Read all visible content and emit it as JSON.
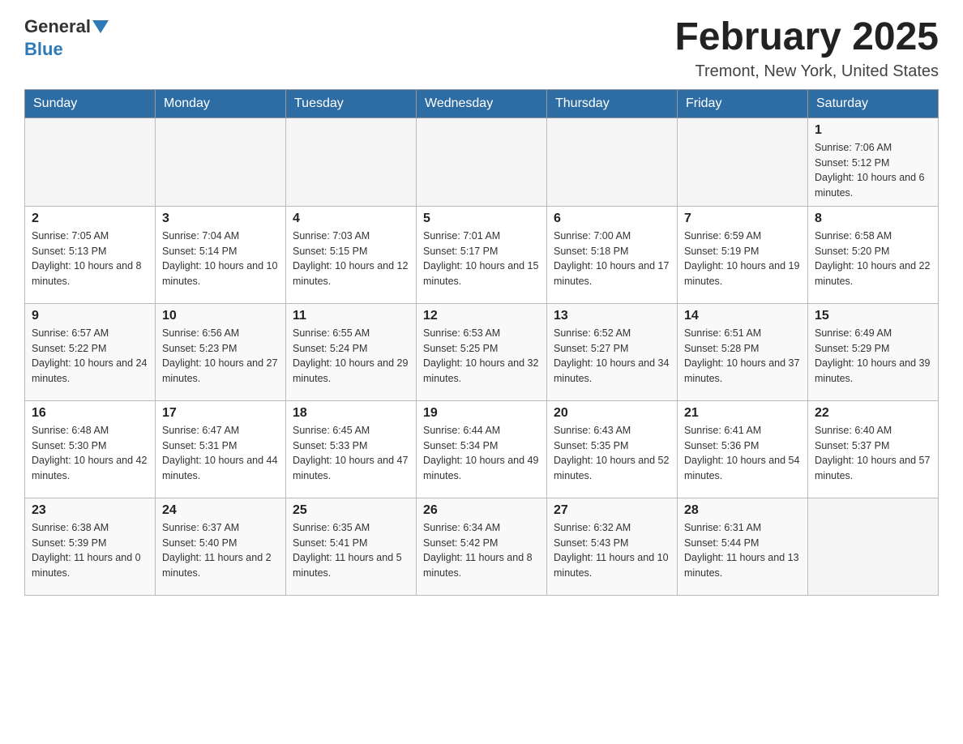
{
  "header": {
    "logo_general": "General",
    "logo_blue": "Blue",
    "title": "February 2025",
    "subtitle": "Tremont, New York, United States"
  },
  "days_of_week": [
    "Sunday",
    "Monday",
    "Tuesday",
    "Wednesday",
    "Thursday",
    "Friday",
    "Saturday"
  ],
  "weeks": [
    {
      "days": [
        {
          "num": "",
          "info": ""
        },
        {
          "num": "",
          "info": ""
        },
        {
          "num": "",
          "info": ""
        },
        {
          "num": "",
          "info": ""
        },
        {
          "num": "",
          "info": ""
        },
        {
          "num": "",
          "info": ""
        },
        {
          "num": "1",
          "info": "Sunrise: 7:06 AM\nSunset: 5:12 PM\nDaylight: 10 hours and 6 minutes."
        }
      ]
    },
    {
      "days": [
        {
          "num": "2",
          "info": "Sunrise: 7:05 AM\nSunset: 5:13 PM\nDaylight: 10 hours and 8 minutes."
        },
        {
          "num": "3",
          "info": "Sunrise: 7:04 AM\nSunset: 5:14 PM\nDaylight: 10 hours and 10 minutes."
        },
        {
          "num": "4",
          "info": "Sunrise: 7:03 AM\nSunset: 5:15 PM\nDaylight: 10 hours and 12 minutes."
        },
        {
          "num": "5",
          "info": "Sunrise: 7:01 AM\nSunset: 5:17 PM\nDaylight: 10 hours and 15 minutes."
        },
        {
          "num": "6",
          "info": "Sunrise: 7:00 AM\nSunset: 5:18 PM\nDaylight: 10 hours and 17 minutes."
        },
        {
          "num": "7",
          "info": "Sunrise: 6:59 AM\nSunset: 5:19 PM\nDaylight: 10 hours and 19 minutes."
        },
        {
          "num": "8",
          "info": "Sunrise: 6:58 AM\nSunset: 5:20 PM\nDaylight: 10 hours and 22 minutes."
        }
      ]
    },
    {
      "days": [
        {
          "num": "9",
          "info": "Sunrise: 6:57 AM\nSunset: 5:22 PM\nDaylight: 10 hours and 24 minutes."
        },
        {
          "num": "10",
          "info": "Sunrise: 6:56 AM\nSunset: 5:23 PM\nDaylight: 10 hours and 27 minutes."
        },
        {
          "num": "11",
          "info": "Sunrise: 6:55 AM\nSunset: 5:24 PM\nDaylight: 10 hours and 29 minutes."
        },
        {
          "num": "12",
          "info": "Sunrise: 6:53 AM\nSunset: 5:25 PM\nDaylight: 10 hours and 32 minutes."
        },
        {
          "num": "13",
          "info": "Sunrise: 6:52 AM\nSunset: 5:27 PM\nDaylight: 10 hours and 34 minutes."
        },
        {
          "num": "14",
          "info": "Sunrise: 6:51 AM\nSunset: 5:28 PM\nDaylight: 10 hours and 37 minutes."
        },
        {
          "num": "15",
          "info": "Sunrise: 6:49 AM\nSunset: 5:29 PM\nDaylight: 10 hours and 39 minutes."
        }
      ]
    },
    {
      "days": [
        {
          "num": "16",
          "info": "Sunrise: 6:48 AM\nSunset: 5:30 PM\nDaylight: 10 hours and 42 minutes."
        },
        {
          "num": "17",
          "info": "Sunrise: 6:47 AM\nSunset: 5:31 PM\nDaylight: 10 hours and 44 minutes."
        },
        {
          "num": "18",
          "info": "Sunrise: 6:45 AM\nSunset: 5:33 PM\nDaylight: 10 hours and 47 minutes."
        },
        {
          "num": "19",
          "info": "Sunrise: 6:44 AM\nSunset: 5:34 PM\nDaylight: 10 hours and 49 minutes."
        },
        {
          "num": "20",
          "info": "Sunrise: 6:43 AM\nSunset: 5:35 PM\nDaylight: 10 hours and 52 minutes."
        },
        {
          "num": "21",
          "info": "Sunrise: 6:41 AM\nSunset: 5:36 PM\nDaylight: 10 hours and 54 minutes."
        },
        {
          "num": "22",
          "info": "Sunrise: 6:40 AM\nSunset: 5:37 PM\nDaylight: 10 hours and 57 minutes."
        }
      ]
    },
    {
      "days": [
        {
          "num": "23",
          "info": "Sunrise: 6:38 AM\nSunset: 5:39 PM\nDaylight: 11 hours and 0 minutes."
        },
        {
          "num": "24",
          "info": "Sunrise: 6:37 AM\nSunset: 5:40 PM\nDaylight: 11 hours and 2 minutes."
        },
        {
          "num": "25",
          "info": "Sunrise: 6:35 AM\nSunset: 5:41 PM\nDaylight: 11 hours and 5 minutes."
        },
        {
          "num": "26",
          "info": "Sunrise: 6:34 AM\nSunset: 5:42 PM\nDaylight: 11 hours and 8 minutes."
        },
        {
          "num": "27",
          "info": "Sunrise: 6:32 AM\nSunset: 5:43 PM\nDaylight: 11 hours and 10 minutes."
        },
        {
          "num": "28",
          "info": "Sunrise: 6:31 AM\nSunset: 5:44 PM\nDaylight: 11 hours and 13 minutes."
        },
        {
          "num": "",
          "info": ""
        }
      ]
    }
  ]
}
